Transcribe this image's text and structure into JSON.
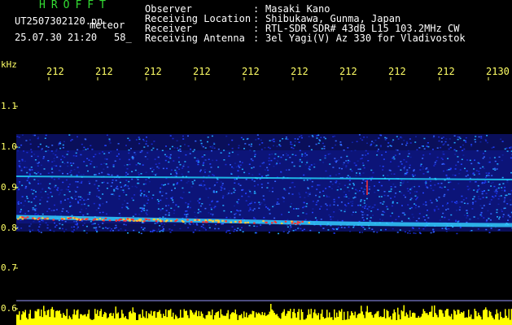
{
  "header": {
    "app_title": "HROFFT",
    "file_name": "UT2507302120.pn",
    "meteor_label": "meteor",
    "datetime": "25.07.30 21:20",
    "count": "58_"
  },
  "info": [
    {
      "key": "Observer",
      "value": "Masaki Kano"
    },
    {
      "key": "Receiving Location",
      "value": "Shibukawa, Gunma, Japan"
    },
    {
      "key": "Receiver",
      "value": "RTL-SDR SDR# 43dB L15 103.2MHz CW"
    },
    {
      "key": "Receiving Antenna",
      "value": "3el Yagi(V) Az 330 for Vladivostok"
    }
  ],
  "separator": ":",
  "axis": {
    "unit": "kHz",
    "time_ticks": [
      "212",
      "212",
      "212",
      "212",
      "212",
      "212",
      "212",
      "212",
      "212",
      "2130"
    ],
    "freq_ticks": [
      "1.1",
      "1.0",
      "0.9",
      "0.8",
      "0.7",
      "0.6"
    ]
  },
  "colors": {
    "title": "#33dd33",
    "tick_labels": "#ffff66",
    "text": "#ffffff",
    "background": "#000000",
    "spectrogram_noise": "#1a2bd0",
    "echo_trace": "#ff3333",
    "power_bar": "#ffff00"
  }
}
